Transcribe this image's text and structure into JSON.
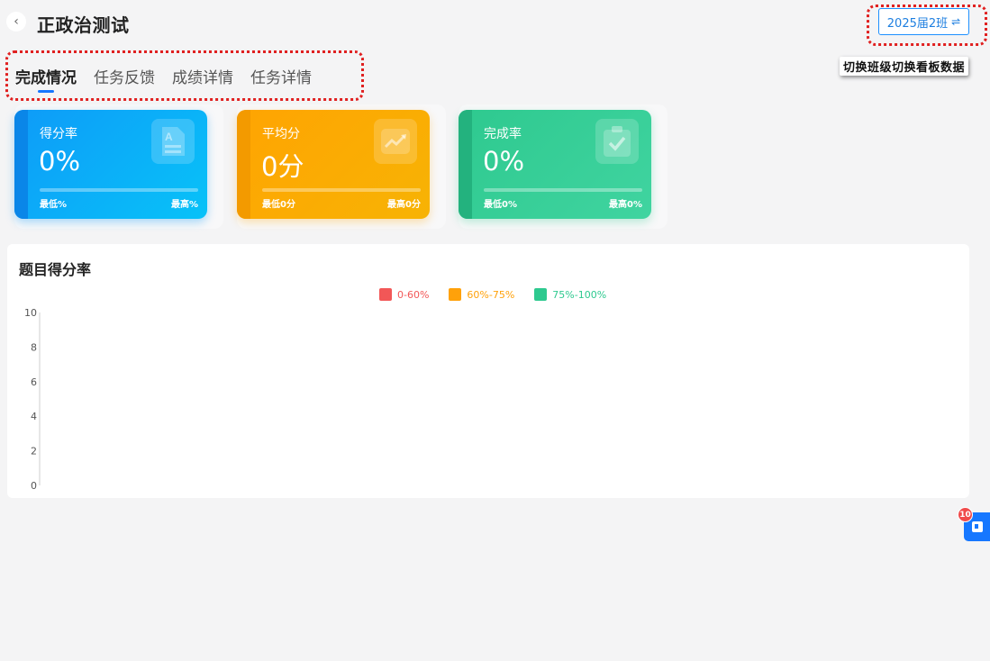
{
  "header": {
    "title": "正政治测试",
    "class_selector": "2025届2班",
    "class_switch_hint": "切换班级切换看板数据"
  },
  "tabs": [
    {
      "label": "完成情况",
      "active": true
    },
    {
      "label": "任务反馈",
      "active": false
    },
    {
      "label": "成绩详情",
      "active": false
    },
    {
      "label": "任务详情",
      "active": false
    }
  ],
  "stats": {
    "score_rate": {
      "label": "得分率",
      "value": "0%",
      "min": "最低%",
      "max": "最高%",
      "progress": 0
    },
    "avg_score": {
      "label": "平均分",
      "value": "0分",
      "min": "最低0分",
      "max": "最高0分",
      "progress": 0
    },
    "completion_rate": {
      "label": "完成率",
      "value": "0%",
      "min": "最低0%",
      "max": "最高0%",
      "progress": 0
    }
  },
  "chart_section": {
    "title": "题目得分率"
  },
  "chart_data": {
    "type": "bar",
    "categories": [],
    "series": [
      {
        "name": "0-60%",
        "values": [],
        "color": "#f25757"
      },
      {
        "name": "60%-75%",
        "values": [],
        "color": "#ffa10a"
      },
      {
        "name": "75%-100%",
        "values": [],
        "color": "#2ec98f"
      }
    ],
    "ylim": [
      0,
      10
    ],
    "yticks": [
      "10",
      "8",
      "6",
      "4",
      "2",
      "0"
    ],
    "legend_position": "top-center"
  },
  "float_widget": {
    "badge": "10"
  },
  "colors": {
    "primary": "#1677ff",
    "blue_card": "#0e9bf8",
    "orange_card": "#ffa402",
    "green_card": "#2ec98f",
    "highlight": "#e02020"
  }
}
